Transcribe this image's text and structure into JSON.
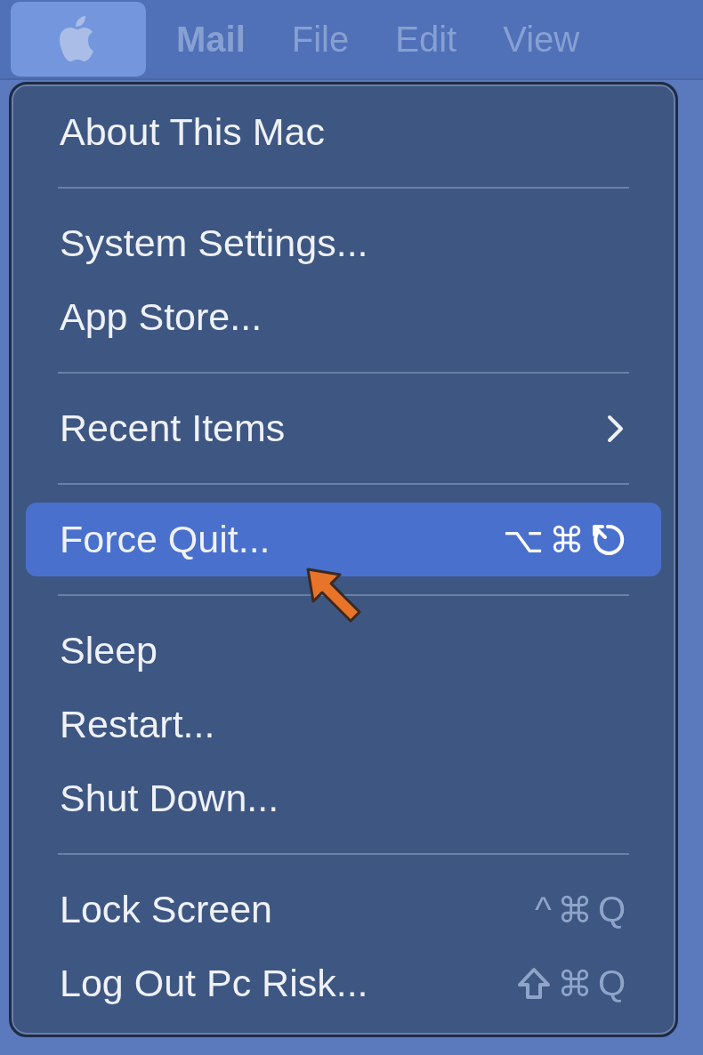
{
  "menu_bar": {
    "items": [
      {
        "kind": "apple",
        "selected": true
      },
      {
        "kind": "app",
        "label": "Mail",
        "selected": false
      },
      {
        "kind": "menu",
        "label": "File",
        "selected": false
      },
      {
        "kind": "menu",
        "label": "Edit",
        "selected": false
      },
      {
        "kind": "menu",
        "label": "View",
        "selected": false
      }
    ]
  },
  "apple_menu": {
    "entries": [
      {
        "kind": "item",
        "label": "About This Mac",
        "selected": false
      },
      {
        "kind": "separator"
      },
      {
        "kind": "item",
        "label": "System Settings...",
        "selected": false
      },
      {
        "kind": "item",
        "label": "App Store...",
        "selected": false
      },
      {
        "kind": "separator"
      },
      {
        "kind": "item",
        "label": "Recent Items",
        "selected": false,
        "submenu": true
      },
      {
        "kind": "separator"
      },
      {
        "kind": "item",
        "label": "Force Quit...",
        "selected": true,
        "shortcut": [
          {
            "kind": "text",
            "label": "⌥"
          },
          {
            "kind": "text",
            "label": "⌘"
          },
          {
            "kind": "escape"
          }
        ]
      },
      {
        "kind": "separator"
      },
      {
        "kind": "item",
        "label": "Sleep",
        "selected": false
      },
      {
        "kind": "item",
        "label": "Restart...",
        "selected": false
      },
      {
        "kind": "item",
        "label": "Shut Down...",
        "selected": false
      },
      {
        "kind": "separator"
      },
      {
        "kind": "item",
        "label": "Lock Screen",
        "selected": false,
        "shortcut": [
          {
            "kind": "text",
            "label": "^"
          },
          {
            "kind": "text",
            "label": "⌘"
          },
          {
            "kind": "text",
            "label": "Q"
          }
        ]
      },
      {
        "kind": "item",
        "label": "Log Out Pc Risk...",
        "selected": false,
        "shortcut": [
          {
            "kind": "shift"
          },
          {
            "kind": "text",
            "label": "⌘"
          },
          {
            "kind": "text",
            "label": "Q"
          }
        ]
      }
    ]
  }
}
